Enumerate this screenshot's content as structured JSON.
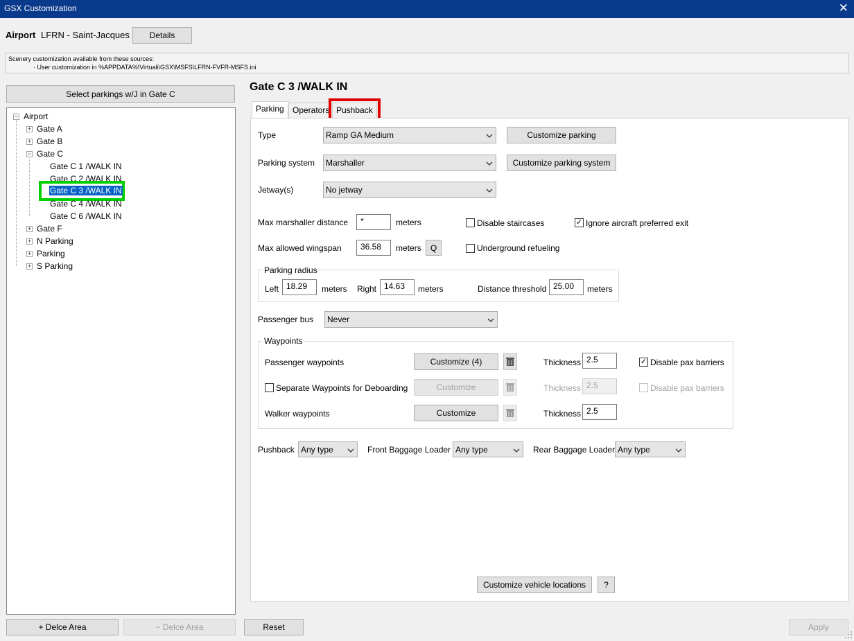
{
  "window": {
    "title": "GSX Customization",
    "close_glyph": "✕"
  },
  "airport": {
    "label": "Airport",
    "value": "LFRN - Saint-Jacques",
    "details_button": "Details"
  },
  "sources": {
    "line1": "Scenery customization available from these sources:",
    "line2": "· User customization in %APPDATA%\\Virtuali\\GSX\\MSFS\\LFRN-FVFR-MSFS.ini"
  },
  "left": {
    "select_button": "Select parkings w/J in Gate C",
    "tree": {
      "root": "Airport",
      "nodes": [
        {
          "label": "Gate A",
          "expander": "+"
        },
        {
          "label": "Gate B",
          "expander": "+"
        },
        {
          "label": "Gate C",
          "expander": "−"
        },
        {
          "label": "Gate C 1 /WALK IN"
        },
        {
          "label": "Gate C 2 /WALK IN"
        },
        {
          "label": "Gate C 3 /WALK IN"
        },
        {
          "label": "Gate C 4 /WALK IN"
        },
        {
          "label": "Gate C 6 /WALK IN"
        },
        {
          "label": "Gate F",
          "expander": "+"
        },
        {
          "label": "N Parking",
          "expander": "+"
        },
        {
          "label": "Parking",
          "expander": "+"
        },
        {
          "label": "S Parking",
          "expander": "+"
        }
      ],
      "root_expander": "−"
    },
    "add_area": "+ Delce Area",
    "remove_area": "− Delce Area"
  },
  "parking": {
    "title": "Gate C 3 /WALK IN",
    "tabs": [
      "Parking",
      "Operators",
      "Pushback"
    ],
    "type_label": "Type",
    "type_value": "Ramp GA Medium",
    "customize_parking": "Customize parking",
    "system_label": "Parking system",
    "system_value": "Marshaller",
    "customize_system": "Customize parking system",
    "jetway_label": "Jetway(s)",
    "jetway_value": "No jetway",
    "max_marshaller_label": "Max marshaller distance",
    "max_marshaller_value": "*",
    "meters": "meters",
    "disable_staircases": "Disable staircases",
    "ignore_exit": "Ignore aircraft preferred exit",
    "max_wingspan_label": "Max allowed wingspan",
    "max_wingspan_value": "36.58",
    "q_button": "Q",
    "underground_refueling": "Underground refueling",
    "radius": {
      "group": "Parking radius",
      "left_label": "Left",
      "left_value": "18.29",
      "right_label": "Right",
      "right_value": "14.63",
      "threshold_label": "Distance threshold",
      "threshold_value": "25.00"
    },
    "bus_label": "Passenger bus",
    "bus_value": "Never",
    "waypoints": {
      "group": "Waypoints",
      "passenger_label": "Passenger waypoints",
      "passenger_button": "Customize (4)",
      "thickness_label": "Thickness",
      "passenger_thickness": "2.5",
      "disable_pax_barriers": "Disable pax barriers",
      "separate_label": "Separate Waypoints for Deboarding",
      "separate_button": "Customize",
      "separate_thickness": "2.5",
      "walker_label": "Walker waypoints",
      "walker_button": "Customize",
      "walker_thickness": "2.5"
    },
    "pushback_label": "Pushback",
    "pushback_value": "Any type",
    "front_loader_label": "Front Baggage Loader",
    "front_loader_value": "Any type",
    "rear_loader_label": "Rear Baggage Loader",
    "rear_loader_value": "Any type",
    "vehicle_locations": "Customize vehicle locations",
    "help": "?"
  },
  "footer": {
    "reset": "Reset",
    "apply": "Apply"
  },
  "highlights": {
    "tab_box_color": "#e00000",
    "tree_box_color": "#00d000",
    "selected_bg": "#0a64c8"
  },
  "icons": {
    "chevron": "chevron-down-icon",
    "check": "✓",
    "trash": "trash-icon"
  }
}
